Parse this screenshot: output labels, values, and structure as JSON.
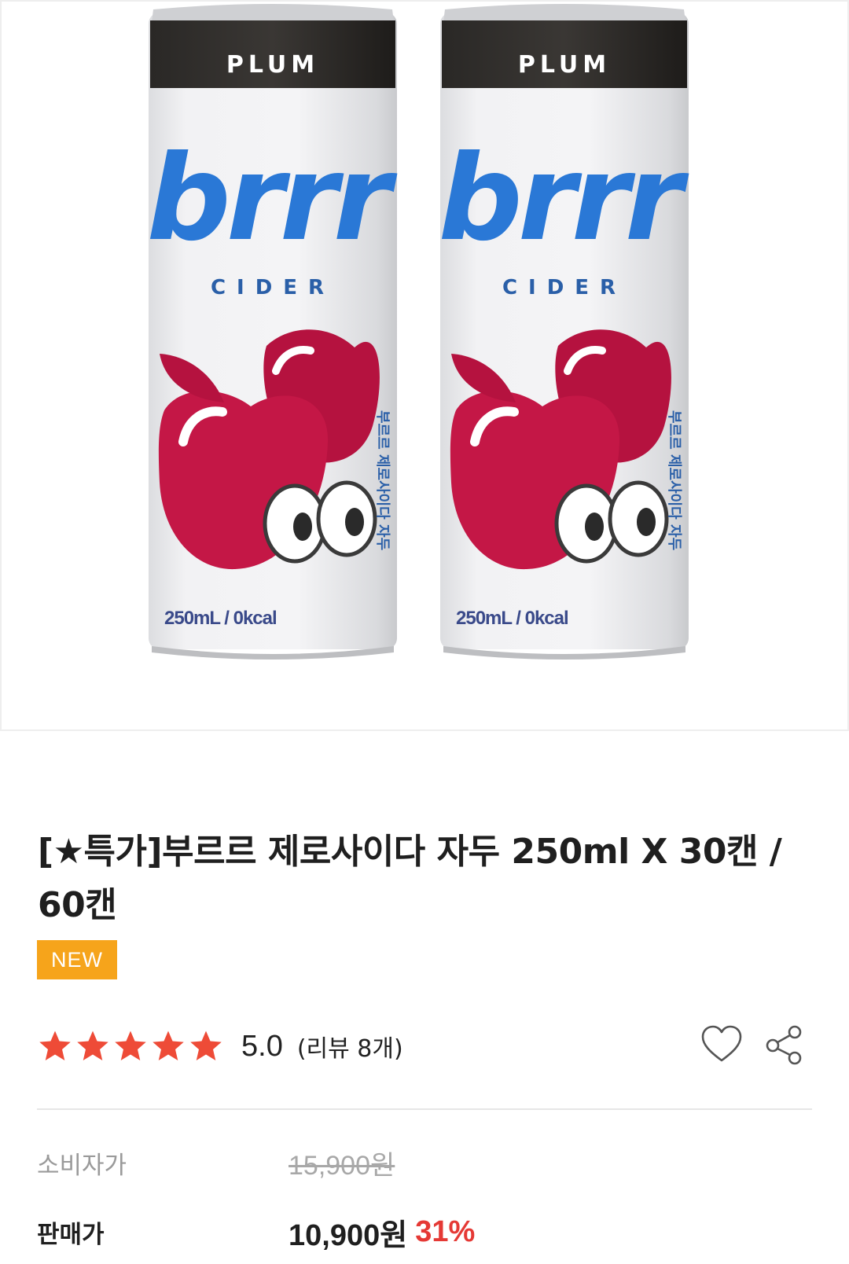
{
  "product_image": {
    "alt_description": "",
    "can": {
      "flavor": "PLUM",
      "brand": "brrr",
      "type": "CIDER",
      "volume_text": "250mL / 0kcal",
      "side_text": "부르르 제로사이다 자두"
    }
  },
  "product": {
    "title": "[★특가]부르르 제로사이다 자두 250ml X 30캔 / 60캔",
    "badge": "NEW"
  },
  "rating": {
    "stars": 5,
    "score": "5.0",
    "review_count": "(리뷰 8개)"
  },
  "prices": {
    "list_label": "소비자가",
    "list_price": "15,900원",
    "sale_label": "판매가",
    "sale_price": "10,900원",
    "discount": "31%"
  },
  "colors": {
    "badge": "#f6a41b",
    "star": "#ee4b37",
    "discount": "#e53935",
    "brand_blue": "#2a78d6",
    "fruit": "#b5123f"
  },
  "icons": [
    "heart-icon",
    "share-icon",
    "star-icon"
  ]
}
